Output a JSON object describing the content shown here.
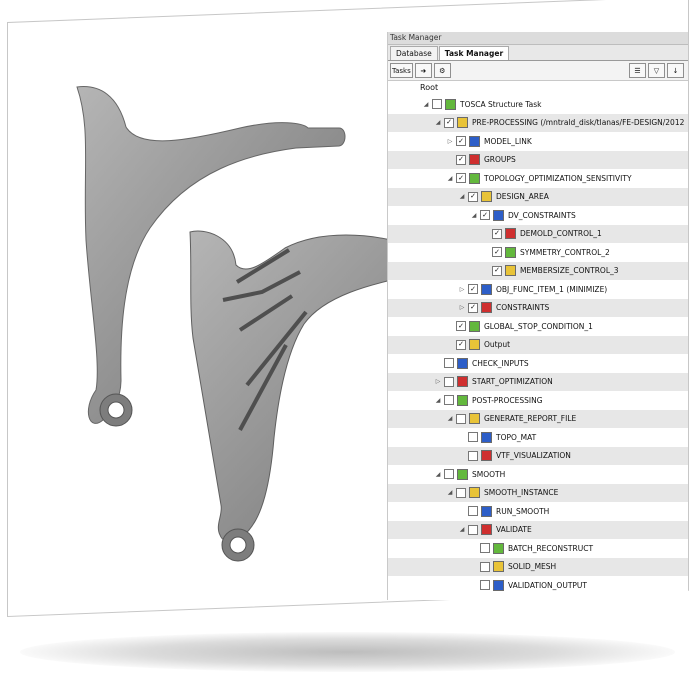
{
  "panel": {
    "title": "Task Manager",
    "tabs": [
      "Database",
      "Task Manager"
    ],
    "toolbar": {
      "tasks_label": "Tasks"
    },
    "root_label": "Root"
  },
  "tree": [
    {
      "label": "TOSCA Structure Task",
      "indent": 0,
      "expanded": true,
      "checked": false,
      "icon": "tosca-icon"
    },
    {
      "label": "PRE-PROCESSING (/mntrald_disk/tlanas/FE-DESIGN/2012",
      "indent": 1,
      "expanded": true,
      "checked": true,
      "icon": "preprocessing-icon"
    },
    {
      "label": "MODEL_LINK",
      "indent": 2,
      "expanded": false,
      "checked": true,
      "icon": "model-link-icon"
    },
    {
      "label": "GROUPS",
      "indent": 2,
      "expanded": null,
      "checked": true,
      "icon": "groups-icon"
    },
    {
      "label": "TOPOLOGY_OPTIMIZATION_SENSITIVITY",
      "indent": 2,
      "expanded": true,
      "checked": true,
      "icon": "topology-icon"
    },
    {
      "label": "DESIGN_AREA",
      "indent": 3,
      "expanded": true,
      "checked": true,
      "icon": "design-area-icon"
    },
    {
      "label": "DV_CONSTRAINTS",
      "indent": 4,
      "expanded": true,
      "checked": true,
      "icon": "dv-constraints-icon"
    },
    {
      "label": "DEMOLD_CONTROL_1",
      "indent": 5,
      "expanded": null,
      "checked": true,
      "icon": "demold-icon"
    },
    {
      "label": "SYMMETRY_CONTROL_2",
      "indent": 5,
      "expanded": null,
      "checked": true,
      "icon": "symmetry-icon"
    },
    {
      "label": "MEMBERSIZE_CONTROL_3",
      "indent": 5,
      "expanded": null,
      "checked": true,
      "icon": "membersize-icon"
    },
    {
      "label": "OBJ_FUNC_ITEM_1 (MINIMIZE)",
      "indent": 3,
      "expanded": false,
      "checked": true,
      "icon": "objective-icon"
    },
    {
      "label": "CONSTRAINTS",
      "indent": 3,
      "expanded": false,
      "checked": true,
      "icon": "constraints-icon"
    },
    {
      "label": "GLOBAL_STOP_CONDITION_1",
      "indent": 2,
      "expanded": null,
      "checked": true,
      "icon": "stop-icon"
    },
    {
      "label": "Output",
      "indent": 2,
      "expanded": null,
      "checked": true,
      "icon": "output-icon"
    },
    {
      "label": "CHECK_INPUTS",
      "indent": 1,
      "expanded": null,
      "checked": false,
      "icon": "check-inputs-icon"
    },
    {
      "label": "START_OPTIMIZATION",
      "indent": 1,
      "expanded": false,
      "checked": false,
      "icon": "start-optimization-icon"
    },
    {
      "label": "POST-PROCESSING",
      "indent": 1,
      "expanded": true,
      "checked": false,
      "icon": "postprocessing-icon"
    },
    {
      "label": "GENERATE_REPORT_FILE",
      "indent": 2,
      "expanded": true,
      "checked": false,
      "icon": "report-icon"
    },
    {
      "label": "TOPO_MAT",
      "indent": 3,
      "expanded": null,
      "checked": false,
      "icon": "topo-mat-icon"
    },
    {
      "label": "VTF_VISUALIZATION",
      "indent": 3,
      "expanded": null,
      "checked": false,
      "icon": "vtf-icon"
    },
    {
      "label": "SMOOTH",
      "indent": 1,
      "expanded": true,
      "checked": false,
      "icon": "smooth-icon"
    },
    {
      "label": "SMOOTH_INSTANCE",
      "indent": 2,
      "expanded": true,
      "checked": false,
      "icon": "smooth-instance-icon"
    },
    {
      "label": "RUN_SMOOTH",
      "indent": 3,
      "expanded": null,
      "checked": false,
      "icon": "run-smooth-icon"
    },
    {
      "label": "VALIDATE",
      "indent": 3,
      "expanded": true,
      "checked": false,
      "icon": "validate-icon"
    },
    {
      "label": "BATCH_RECONSTRUCT",
      "indent": 4,
      "expanded": null,
      "checked": false,
      "icon": "batch-reconstruct-icon"
    },
    {
      "label": "SOLID_MESH",
      "indent": 4,
      "expanded": null,
      "checked": false,
      "icon": "solid-mesh-icon"
    },
    {
      "label": "VALIDATION_OUTPUT",
      "indent": 4,
      "expanded": null,
      "checked": false,
      "icon": "validation-output-icon"
    }
  ],
  "colors": {
    "icon_green": "#63b83d",
    "icon_yellow": "#e8c338",
    "icon_blue": "#2d5ec8",
    "icon_red": "#cf2f2f",
    "model_gray": "#8b8b8b"
  }
}
